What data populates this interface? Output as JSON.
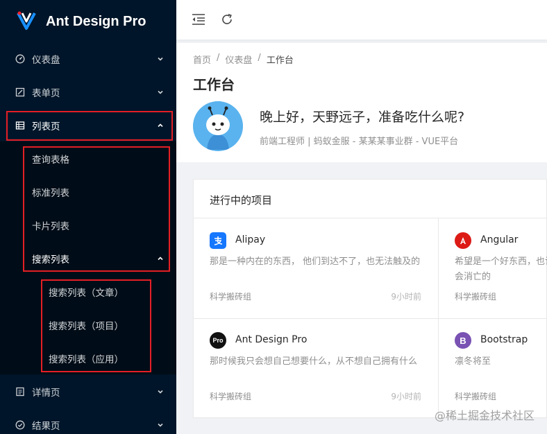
{
  "app": {
    "title": "Ant Design Pro"
  },
  "sidebar": {
    "items": [
      {
        "label": "仪表盘",
        "icon": "dashboard-icon"
      },
      {
        "label": "表单页",
        "icon": "form-icon"
      },
      {
        "label": "列表页",
        "icon": "table-icon"
      },
      {
        "label": "查询表格"
      },
      {
        "label": "标准列表"
      },
      {
        "label": "卡片列表"
      },
      {
        "label": "搜索列表"
      },
      {
        "label": "搜索列表（文章）"
      },
      {
        "label": "搜索列表（项目）"
      },
      {
        "label": "搜索列表（应用）"
      },
      {
        "label": "详情页",
        "icon": "profile-icon"
      },
      {
        "label": "结果页",
        "icon": "check-circle-icon"
      }
    ]
  },
  "breadcrumb": [
    "首页",
    "/",
    "仪表盘",
    "/",
    "工作台"
  ],
  "page": {
    "title": "工作台",
    "greeting": "晚上好，天野远子，准备吃什么呢?",
    "profile": "前端工程师 | 蚂蚁金服 - 某某某事业群 - VUE平台"
  },
  "projects": {
    "title": "进行中的项目",
    "items": [
      {
        "name": "Alipay",
        "desc": "那是一种内在的东西， 他们到达不了，也无法触及的",
        "group": "科学搬砖组",
        "time": "9小时前",
        "color": "#1677ff"
      },
      {
        "name": "Angular",
        "desc": "希望是一个好东西，也许是最好的，好东西是不会消亡的",
        "group": "科学搬砖组",
        "time": "",
        "color": "#dd1b16"
      },
      {
        "name": "Ant Design Pro",
        "desc": "那时候我只会想自己想要什么，从不想自己拥有什么",
        "group": "科学搬砖组",
        "time": "9小时前",
        "color": "#111111"
      },
      {
        "name": "Bootstrap",
        "desc": "凛冬将至",
        "group": "科学搬砖组",
        "time": "",
        "color": "#7952b3"
      }
    ]
  },
  "watermark": "@稀土掘金技术社区"
}
